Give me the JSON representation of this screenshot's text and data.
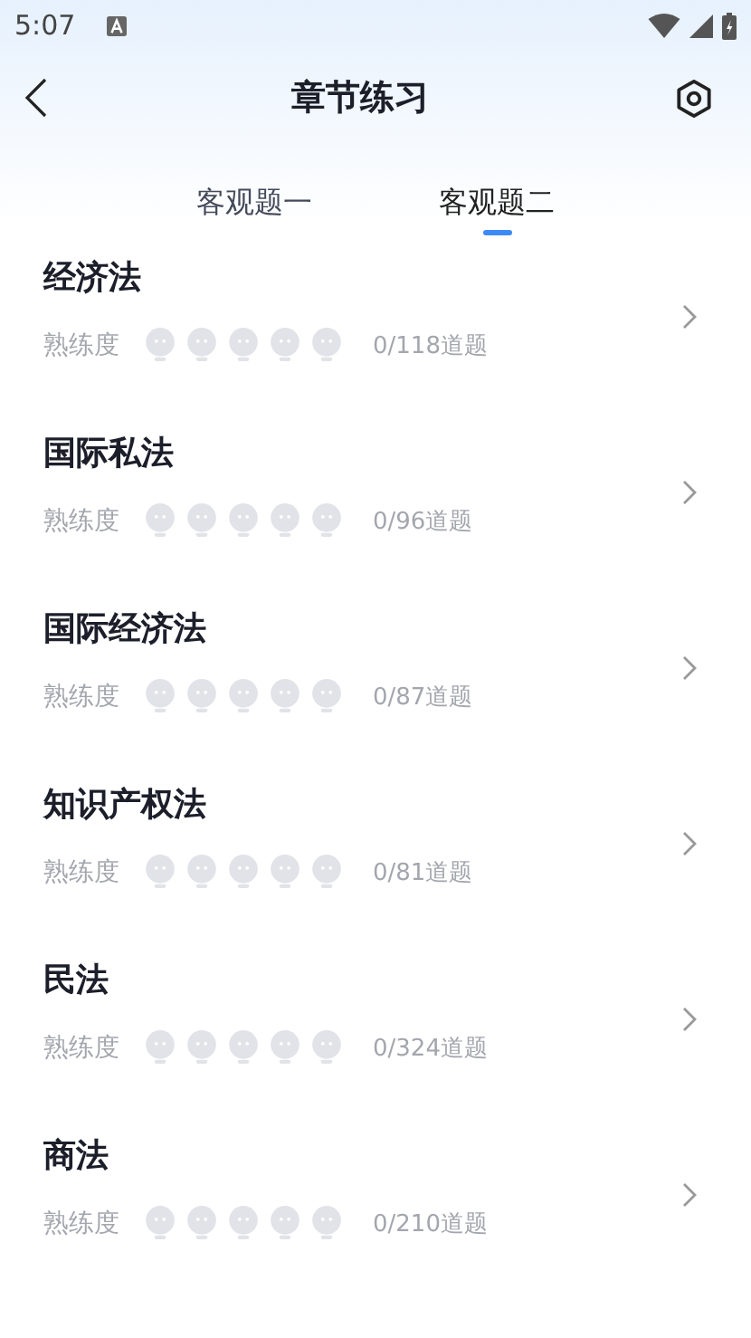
{
  "status_bar": {
    "time": "5:07"
  },
  "header": {
    "title": "章节练习"
  },
  "tabs": [
    {
      "label": "客观题一",
      "selected": false
    },
    {
      "label": "客观题二",
      "selected": true
    }
  ],
  "chapters": [
    {
      "name": "经济法",
      "proficiency_label": "熟练度",
      "stars": 0,
      "count": "0/118道题"
    },
    {
      "name": "国际私法",
      "proficiency_label": "熟练度",
      "stars": 0,
      "count": "0/96道题"
    },
    {
      "name": "国际经济法",
      "proficiency_label": "熟练度",
      "stars": 0,
      "count": "0/87道题"
    },
    {
      "name": "知识产权法",
      "proficiency_label": "熟练度",
      "stars": 0,
      "count": "0/81道题"
    },
    {
      "name": "民法",
      "proficiency_label": "熟练度",
      "stars": 0,
      "count": "0/324道题"
    },
    {
      "name": "商法",
      "proficiency_label": "熟练度",
      "stars": 0,
      "count": "0/210道题"
    }
  ]
}
